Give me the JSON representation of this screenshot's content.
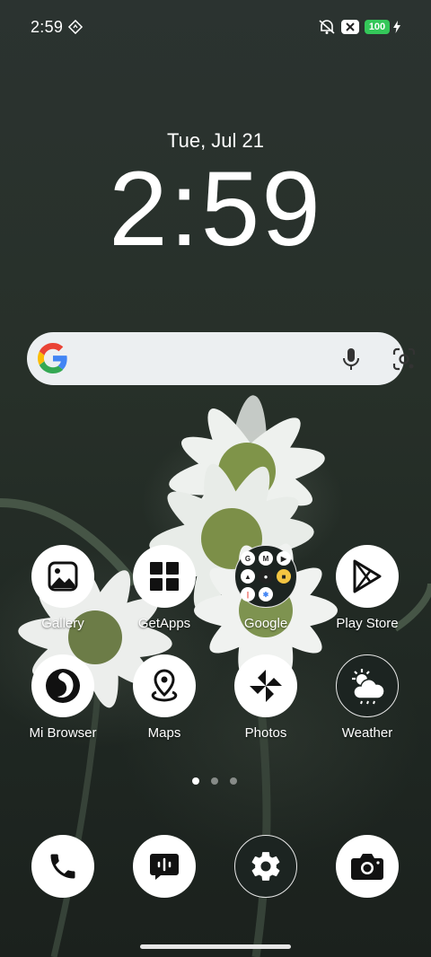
{
  "status_bar": {
    "time": "2:59",
    "battery": "100",
    "icons": [
      "navigation-diamond-icon",
      "mute-icon",
      "close-box-icon",
      "charging-bolt-icon"
    ]
  },
  "lockscreen": {
    "date": "Tue, Jul 21",
    "clock": "2:59"
  },
  "search_bar": {
    "icons": [
      "google-g-icon",
      "microphone-icon",
      "google-lens-icon"
    ]
  },
  "apps": [
    {
      "label": "Gallery",
      "icon": "gallery-icon"
    },
    {
      "label": "GetApps",
      "icon": "getapps-grid-icon"
    },
    {
      "label": "Google",
      "icon": "google-folder-icon"
    },
    {
      "label": "Play Store",
      "icon": "play-store-icon"
    },
    {
      "label": "Mi Browser",
      "icon": "mi-browser-icon"
    },
    {
      "label": "Maps",
      "icon": "maps-pin-icon"
    },
    {
      "label": "Photos",
      "icon": "photos-pinwheel-icon"
    },
    {
      "label": "Weather",
      "icon": "weather-icon"
    }
  ],
  "page_indicator": {
    "pages": 3,
    "current": 1
  },
  "dock": [
    {
      "icon": "phone-icon"
    },
    {
      "icon": "messages-icon"
    },
    {
      "icon": "settings-gear-icon"
    },
    {
      "icon": "camera-icon"
    }
  ]
}
